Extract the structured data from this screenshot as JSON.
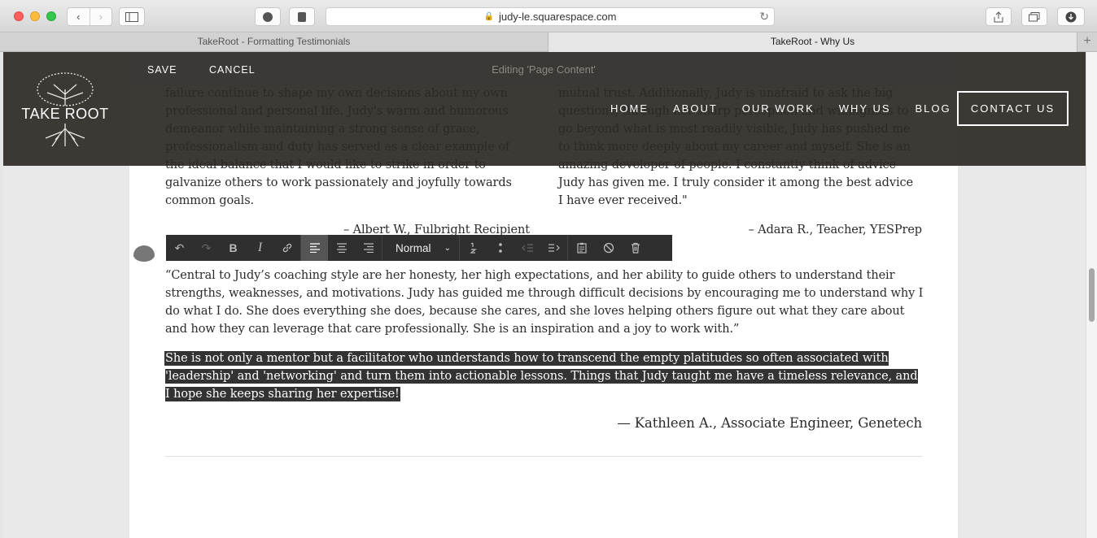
{
  "browser": {
    "url": "judy-le.squarespace.com",
    "tabs": [
      {
        "label": "TakeRoot - Formatting Testimonials",
        "active": false
      },
      {
        "label": "TakeRoot - Why Us",
        "active": true
      }
    ]
  },
  "editbar": {
    "save": "SAVE",
    "cancel": "CANCEL",
    "editing": "Editing 'Page Content'"
  },
  "header": {
    "logo_text": "TAKE ROOT",
    "nav": [
      "HOME",
      "ABOUT",
      "OUR WORK",
      "WHY US",
      "BLOG"
    ],
    "contact": "CONTACT US"
  },
  "testimonials": {
    "left_column": "failure continue to shape my own decisions about my own professional and personal life. Judy's warm and humorous demeanor while maintaining a strong sense of grace, professionalism and duty has served as a clear example of the ideal balance that I would like to strike in order to galvanize others to work passionately and joyfully towards common goals.",
    "left_attribution": "– Albert W., Fulbright Recipient",
    "right_column": "mutual trust. Additionally, Judy is unafraid to ask the big questions, through her sharp perception and willingness to go beyond what is most readily visible, Judy has pushed me to think more deeply about my career and myself. She is an amazing developer of people. I constantly think of advice Judy has given me. I truly consider it among the best advice I have ever received.\"",
    "right_attribution": "– Adara R., Teacher, YESPrep",
    "paragraph": "“Central to Judy’s coaching style are her honesty, her high expectations, and her ability to guide others to understand their strengths, weaknesses, and motivations. Judy has guided me through difficult decisions by encouraging me to understand why I do what I do. She does everything she does, because she cares, and she loves helping others figure out what they care about and how they can leverage that care professionally. She is an inspiration and a joy to work with.”",
    "selected_text": "She is not only a mentor but a facilitator who understands how to transcend the empty platitudes so often associated with 'leadership' and 'networking' and turn them into actionable lessons. Things that Judy taught me have a timeless relevance, and I hope she keeps sharing her expertise!",
    "signature": "— Kathleen A., Associate Engineer, Genetech"
  },
  "toolbar": {
    "style_select": "Normal"
  }
}
